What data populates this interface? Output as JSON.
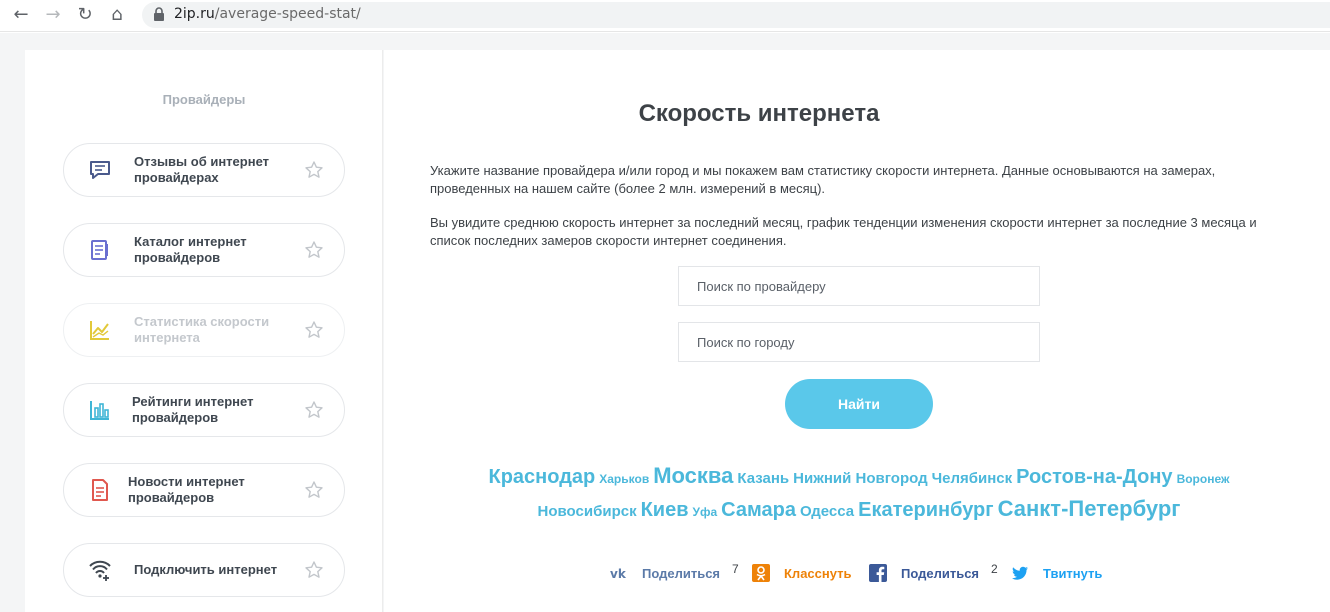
{
  "browser": {
    "back_icon": "arrow-left-icon",
    "forward_icon": "arrow-right-icon",
    "reload_icon": "reload-icon",
    "home_icon": "home-icon",
    "url_domain": "2ip.ru",
    "url_path": "/average-speed-stat/"
  },
  "sidebar": {
    "title": "Провайдеры",
    "items": [
      {
        "label": "Отзывы об интернет провайдерах",
        "icon": "comment-icon",
        "color": "#4a5a8c"
      },
      {
        "label": "Каталог интернет провайдеров",
        "icon": "catalog-icon",
        "color": "#6a6fd0"
      },
      {
        "label": "Статистика скорости интернета",
        "icon": "chart-icon",
        "color": "#e2c93a"
      },
      {
        "label": "Рейтинги интернет провайдеров",
        "icon": "bar-chart-icon",
        "color": "#3fb6d6"
      },
      {
        "label": "Новости интернет провайдеров",
        "icon": "news-icon",
        "color": "#e0584f"
      },
      {
        "label": "Подключить интернет",
        "icon": "wifi-plus-icon",
        "color": "#3f4750"
      }
    ]
  },
  "main": {
    "title": "Скорость интернета",
    "paragraph1": "Укажите название провайдера и/или город и мы покажем вам статистику скорости интернета. Данные основываются на замерах, проведенных на нашем сайте (более 2 млн. измерений в месяц).",
    "paragraph2": "Вы увидите среднюю скорость интернет за последний месяц, график тенденции изменения скорости интернет за последние 3 месяца и список последних замеров скорости интернет соединения.",
    "provider_placeholder": "Поиск по провайдеру",
    "city_placeholder": "Поиск по городу",
    "find_label": "Найти",
    "cities_row1": [
      {
        "name": "Краснодар",
        "size": "large"
      },
      {
        "name": "Харьков",
        "size": "small"
      },
      {
        "name": "Москва",
        "size": "xlarge"
      },
      {
        "name": "Казань",
        "size": "medium"
      },
      {
        "name": "Нижний Новгород",
        "size": "medium"
      },
      {
        "name": "Челябинск",
        "size": "medium"
      },
      {
        "name": "Ростов-на-Дону",
        "size": "large"
      },
      {
        "name": "Воронеж",
        "size": "small"
      }
    ],
    "cities_row2": [
      {
        "name": "Новосибирск",
        "size": "medium"
      },
      {
        "name": "Киев",
        "size": "large"
      },
      {
        "name": "Уфа",
        "size": "small"
      },
      {
        "name": "Самара",
        "size": "large"
      },
      {
        "name": "Одесса",
        "size": "medium"
      },
      {
        "name": "Екатеринбург",
        "size": "large"
      },
      {
        "name": "Санкт-Петербург",
        "size": "xlarge"
      }
    ],
    "share": {
      "vk_label": "Поделиться",
      "vk_count": "7",
      "vk_icon": "vk-icon",
      "vk_color": "#5b7aa8",
      "ok_label": "Класснуть",
      "ok_icon": "odnoklassniki-icon",
      "ok_color": "#ee8208",
      "fb_label": "Поделиться",
      "fb_count": "2",
      "fb_icon": "facebook-icon",
      "fb_color": "#3b5998",
      "tw_label": "Твитнуть",
      "tw_icon": "twitter-icon",
      "tw_color": "#1da1f2"
    }
  }
}
